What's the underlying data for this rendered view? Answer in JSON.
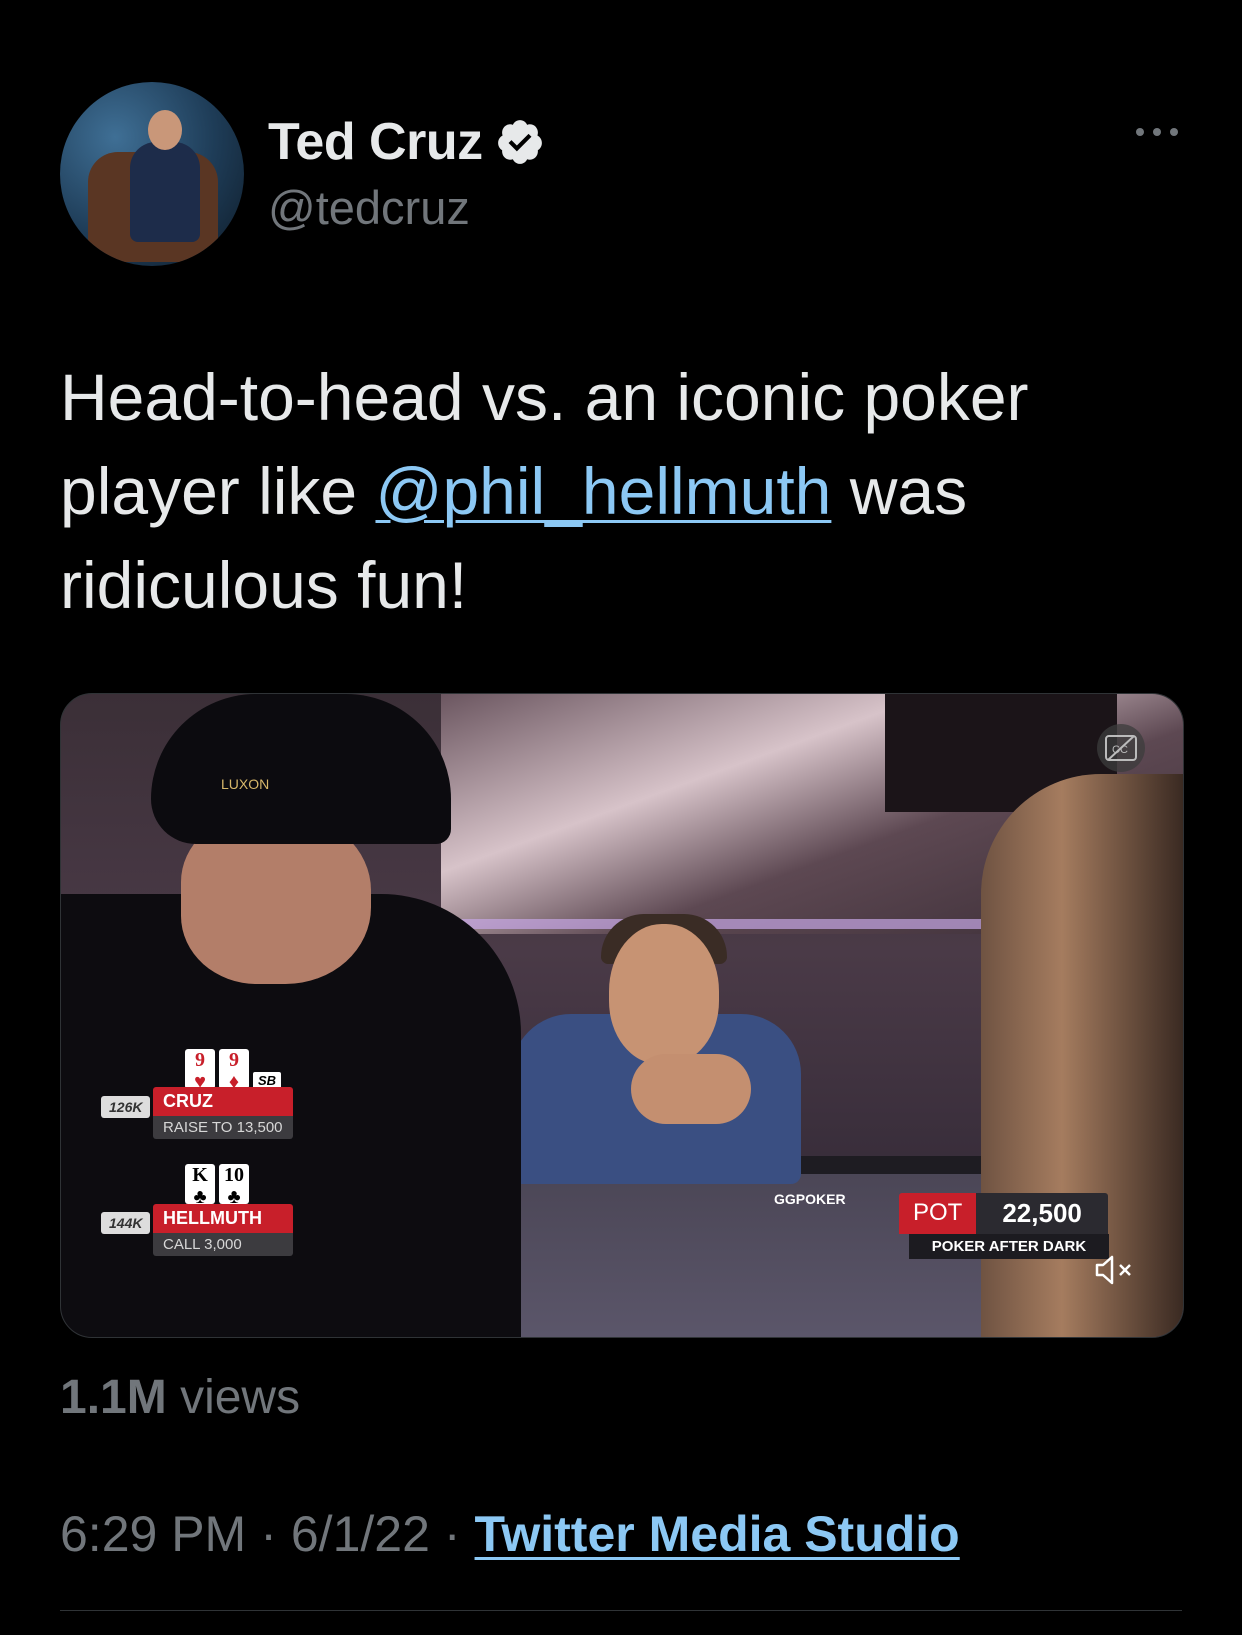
{
  "author": {
    "name": "Ted Cruz",
    "handle": "@tedcruz",
    "verified_icon": "verified-badge-icon"
  },
  "tweet": {
    "text_before": "Head-to-head vs. an iconic poker player like ",
    "mention": "@phil_hellmuth",
    "text_after": " was ridiculous fun!"
  },
  "video_overlay": {
    "player1": {
      "chips": "126K",
      "name": "CRUZ",
      "action": "RAISE TO 13,500",
      "position_badge": "SB",
      "cards": [
        "9",
        "9"
      ]
    },
    "player2": {
      "chips": "144K",
      "name": "HELLMUTH",
      "action": "CALL 3,000",
      "cards": [
        "K",
        "10"
      ]
    },
    "pot_label": "POT",
    "pot_value": "22,500",
    "show_name": "POKER AFTER DARK",
    "table_brand": "GGPOKER",
    "cap_text": "LUXON"
  },
  "stats": {
    "views_value": "1.1M",
    "views_label": "views"
  },
  "meta": {
    "time": "6:29 PM",
    "date": "6/1/22",
    "separator": "·",
    "source": "Twitter Media Studio"
  },
  "colors": {
    "background": "#000000",
    "text": "#e7e9ea",
    "secondary": "#71767b",
    "link": "#8cc8f4",
    "accent_red": "#c81f2a"
  }
}
